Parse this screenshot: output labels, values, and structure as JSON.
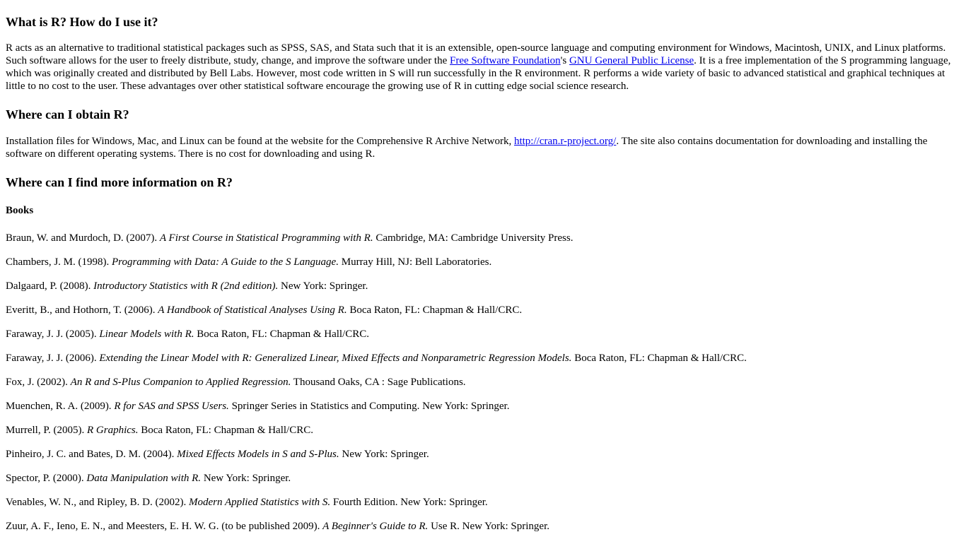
{
  "sections": {
    "what": {
      "heading": "What is R? How do I use it?",
      "para_part1": "R acts as an alternative to traditional statistical packages such as SPSS, SAS, and Stata such that it is an extensible, open-source language and computing environment for Windows, Macintosh, UNIX, and Linux platforms. Such software allows for the user to freely distribute, study, change, and improve the software under the ",
      "link_fsf": "Free Software Foundation",
      "para_part2": "'s ",
      "link_gpl": "GNU General Public License",
      "para_part3": ". It is a free implementation of the S programming language, which was originally created and distributed by Bell Labs. However, most code written in S will run successfully in the R environment. R performs a wide variety of basic to advanced statistical and graphical techniques at little to no cost to the user. These advantages over other statistical software encourage the growing use of R in cutting edge social science research."
    },
    "obtain": {
      "heading": "Where can I obtain R?",
      "para_part1": "Installation files for Windows, Mac, and Linux can be found at the website for the Comprehensive R Archive Network, ",
      "link_cran": "http://cran.r-project.org/",
      "para_part2": ". The site also contains documentation for downloading and installing the software on different operating systems. There is no cost for downloading and using R."
    },
    "more": {
      "heading": "Where can I find more information on R?",
      "books_heading": "Books"
    }
  },
  "colors": {
    "link": "#0000EE",
    "text": "#000000",
    "background": "#FFFFFF"
  },
  "books": [
    {
      "authors": "Braun, W. and Murdoch, D. (2007). ",
      "title": "A First Course in Statistical Programming with R.",
      "publisher": " Cambridge, MA: Cambridge University Press."
    },
    {
      "authors": "Chambers, J. M. (1998). ",
      "title": "Programming with Data: A Guide to the S Language.",
      "publisher": " Murray Hill, NJ: Bell Laboratories."
    },
    {
      "authors": "Dalgaard, P. (2008). ",
      "title": "Introductory Statistics with R (2nd edition).",
      "publisher": " New York: Springer."
    },
    {
      "authors": "Everitt, B., and Hothorn, T. (2006). ",
      "title": "A Handbook of Statistical Analyses Using R.",
      "publisher": " Boca Raton, FL: Chapman & Hall/CRC."
    },
    {
      "authors": "Faraway, J. J. (2005). ",
      "title": "Linear Models with R.",
      "publisher": " Boca Raton, FL: Chapman & Hall/CRC."
    },
    {
      "authors": "Faraway, J. J. (2006). ",
      "title": "Extending the Linear Model with R: Generalized Linear, Mixed Effects and Nonparametric Regression Models.",
      "publisher": " Boca Raton, FL: Chapman & Hall/CRC."
    },
    {
      "authors": "Fox, J. (2002). ",
      "title": "An R and S-Plus Companion to Applied Regression.",
      "publisher": " Thousand Oaks, CA : Sage Publications."
    },
    {
      "authors": "Muenchen, R. A. (2009). ",
      "title": "R for SAS and SPSS Users.",
      "publisher": " Springer Series in Statistics and Computing. New York: Springer."
    },
    {
      "authors": "Murrell, P. (2005). ",
      "title": "R Graphics.",
      "publisher": " Boca Raton, FL: Chapman & Hall/CRC."
    },
    {
      "authors": "Pinheiro, J. C. and Bates, D. M. (2004). ",
      "title": "Mixed Effects Models in S and S-Plus.",
      "publisher": " New York: Springer."
    },
    {
      "authors": "Spector, P. (2000). ",
      "title": "Data Manipulation with R.",
      "publisher": " New York: Springer."
    },
    {
      "authors": "Venables, W. N., and Ripley, B. D. (2002). ",
      "title": "Modern Applied Statistics with S.",
      "publisher": " Fourth Edition. New York: Springer."
    },
    {
      "authors": "Zuur, A. F., Ieno, E. N., and Meesters, E. H. W. G. (to be published 2009). ",
      "title": "A Beginner's Guide to R.",
      "publisher": " Use R. New York: Springer."
    }
  ]
}
